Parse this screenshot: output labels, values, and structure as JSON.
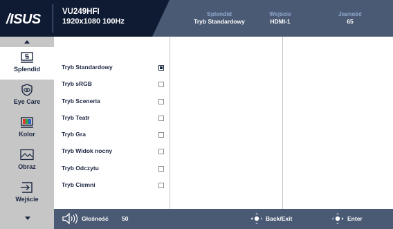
{
  "header": {
    "brand_logo_text": "/ISUS",
    "model": "VU249HFI",
    "resolution": "1920x1080 100Hz",
    "stats": [
      {
        "label": "Splendid",
        "value": "Tryb Standardowy"
      },
      {
        "label": "Wejście",
        "value": "HDMI-1"
      },
      {
        "label": "Jasność",
        "value": "65"
      }
    ]
  },
  "sidebar": {
    "items": [
      {
        "label": "Splendid",
        "icon": "splendid-icon",
        "active": true
      },
      {
        "label": "Eye Care",
        "icon": "eye-care-icon",
        "active": false
      },
      {
        "label": "Kolor",
        "icon": "color-icon",
        "active": false
      },
      {
        "label": "Obraz",
        "icon": "image-icon",
        "active": false
      },
      {
        "label": "Wejście",
        "icon": "input-icon",
        "active": false
      }
    ]
  },
  "options": [
    {
      "label": "Tryb Standardowy",
      "selected": true
    },
    {
      "label": "Tryb sRGB",
      "selected": false
    },
    {
      "label": "Tryb Sceneria",
      "selected": false
    },
    {
      "label": "Tryb Teatr",
      "selected": false
    },
    {
      "label": "Tryb Gra",
      "selected": false
    },
    {
      "label": "Tryb Widok nocny",
      "selected": false
    },
    {
      "label": "Tryb Odczytu",
      "selected": false
    },
    {
      "label": "Tryb Ciemni",
      "selected": false
    }
  ],
  "footer": {
    "volume_label": "Głośność",
    "volume_value": "50",
    "back_label": "Back/Exit",
    "enter_label": "Enter"
  },
  "colors": {
    "header_bg": "#4a5a74",
    "header_dark": "#0f1a33",
    "sidebar_bg": "#c6c6c6",
    "text_dark": "#1a2540",
    "header_label": "#8fa6cc"
  }
}
